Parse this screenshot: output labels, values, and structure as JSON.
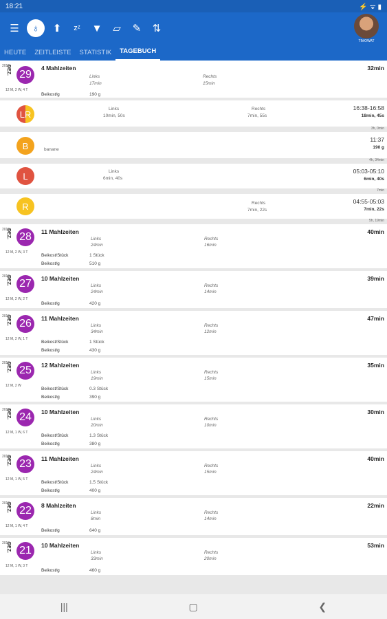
{
  "statusbar": {
    "time": "18:21",
    "icons": "⚡ ᯤ ▮"
  },
  "toolbar": {
    "avatar_label": "TIMOWAT"
  },
  "tabs": [
    "HEUTE",
    "ZEITLEISTE",
    "STATISTIK",
    "TAGEBUCH"
  ],
  "today": {
    "year": "2019",
    "month": "DEZ.",
    "day": "29",
    "week": "12 M, 2 W, 4 T",
    "meals": "4 Mahlzeiten",
    "total": "32min",
    "left_label": "Links",
    "left_val": "17min",
    "right_label": "Rechts",
    "right_val": "15min",
    "b1_label": "Beikost/g",
    "b1_val": "190 g"
  },
  "entries": [
    {
      "icon": "LR",
      "left_label": "Links",
      "left_val": "10min, 50s",
      "right_label": "Rechts",
      "right_val": "7min, 55s",
      "time": "16:38-16:58",
      "dur": "18min, 45s",
      "gap": "3h, 0min"
    },
    {
      "icon": "B",
      "note": "banane",
      "time": "11:37",
      "dur": "190 g",
      "gap": "4h, 34min"
    },
    {
      "icon": "L",
      "left_label": "Links",
      "left_val": "6min, 40s",
      "time": "05:03-05:10",
      "dur": "6min, 40s",
      "gap": "7min"
    },
    {
      "icon": "R",
      "right_label": "Rechts",
      "right_val": "7min, 22s",
      "time": "04:55-05:03",
      "dur": "7min, 22s",
      "gap": "5h, 19min"
    }
  ],
  "days": [
    {
      "year": "2019",
      "month": "DEZ.",
      "day": "28",
      "week": "12 M, 2 W, 3 T",
      "meals": "11 Mahlzeiten",
      "total": "40min",
      "left": "24min",
      "right": "16min",
      "b1_label": "Beikost/Stück",
      "b1_val": "1 Stück",
      "b2_label": "Beikost/g",
      "b2_val": "510 g"
    },
    {
      "year": "2019",
      "month": "DEZ.",
      "day": "27",
      "week": "12 M, 2 W, 2 T",
      "meals": "10 Mahlzeiten",
      "total": "39min",
      "left": "24min",
      "right": "14min",
      "b1_label": "Beikost/g",
      "b1_val": "420 g"
    },
    {
      "year": "2019",
      "month": "DEZ.",
      "day": "26",
      "week": "12 M, 2 W, 1 T",
      "meals": "11 Mahlzeiten",
      "total": "47min",
      "left": "34min",
      "right": "12min",
      "b1_label": "Beikost/Stück",
      "b1_val": "1 Stück",
      "b2_label": "Beikost/g",
      "b2_val": "430 g"
    },
    {
      "year": "2019",
      "month": "DEZ.",
      "day": "25",
      "week": "12 M, 2 W",
      "meals": "12 Mahlzeiten",
      "total": "35min",
      "left": "19min",
      "right": "15min",
      "b1_label": "Beikost/Stück",
      "b1_val": "0.3 Stück",
      "b2_label": "Beikost/g",
      "b2_val": "390 g"
    },
    {
      "year": "2019",
      "month": "DEZ.",
      "day": "24",
      "week": "12 M, 1 W, 6 T",
      "meals": "10 Mahlzeiten",
      "total": "30min",
      "left": "20min",
      "right": "10min",
      "b1_label": "Beikost/Stück",
      "b1_val": "1.3 Stück",
      "b2_label": "Beikost/g",
      "b2_val": "380 g"
    },
    {
      "year": "2019",
      "month": "DEZ.",
      "day": "23",
      "week": "12 M, 1 W, 5 T",
      "meals": "11 Mahlzeiten",
      "total": "40min",
      "left": "24min",
      "right": "15min",
      "b1_label": "Beikost/Stück",
      "b1_val": "1.5 Stück",
      "b2_label": "Beikost/g",
      "b2_val": "400 g"
    },
    {
      "year": "2019",
      "month": "DEZ.",
      "day": "22",
      "week": "12 M, 1 W, 4 T",
      "meals": "8 Mahlzeiten",
      "total": "22min",
      "left": "8min",
      "right": "14min",
      "b1_label": "Beikost/g",
      "b1_val": "640 g"
    },
    {
      "year": "2019",
      "month": "DEZ.",
      "day": "21",
      "week": "12 M, 1 W, 3 T",
      "meals": "10 Mahlzeiten",
      "total": "53min",
      "left": "33min",
      "right": "20min",
      "b1_label": "Beikost/g",
      "b1_val": "460 g"
    }
  ],
  "labels": {
    "left": "Links",
    "right": "Rechts"
  }
}
